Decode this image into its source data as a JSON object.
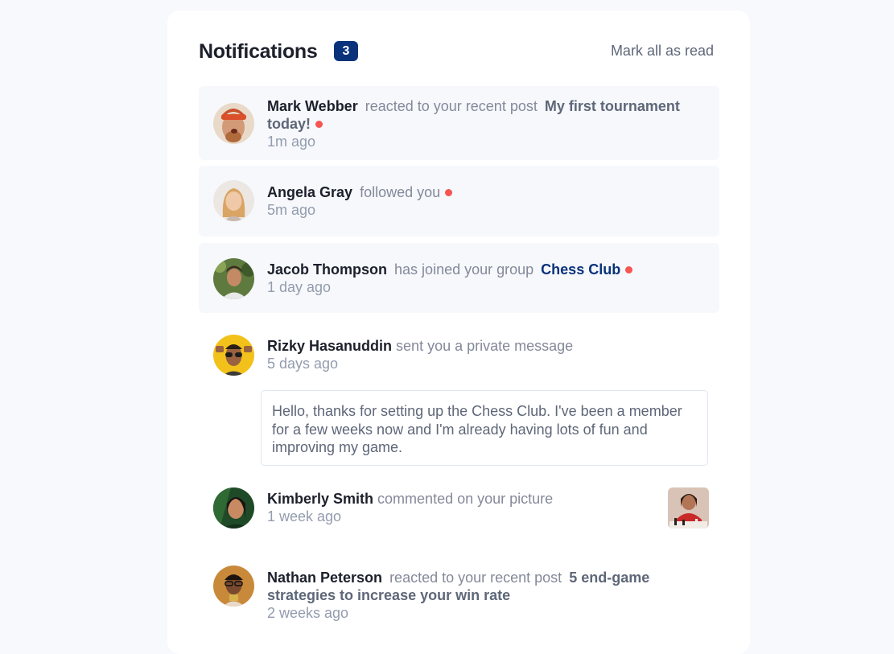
{
  "header": {
    "title": "Notifications",
    "unread_count": "3",
    "mark_all_label": "Mark all as read"
  },
  "notifications": [
    {
      "name": "Mark Webber",
      "action": "reacted to your recent post",
      "target": "My first tournament today!",
      "time": "1m ago",
      "unread": true
    },
    {
      "name": "Angela Gray",
      "action": "followed you",
      "time": "5m ago",
      "unread": true
    },
    {
      "name": "Jacob Thompson",
      "action": "has joined your group",
      "target": "Chess Club",
      "time": "1 day ago",
      "unread": true
    },
    {
      "name": "Rizky Hasanuddin",
      "action": "sent you a private message",
      "time": "5 days ago",
      "message": "Hello, thanks for setting up the Chess Club. I've been a member for a few weeks now and I'm already having lots of fun and improving my game.",
      "unread": false
    },
    {
      "name": "Kimberly Smith",
      "action": "commented on your picture",
      "time": "1 week ago",
      "unread": false
    },
    {
      "name": "Nathan Peterson",
      "action": "reacted to your recent post",
      "target": "5 end-game strategies to increase your win rate",
      "time": "2 weeks ago",
      "unread": false
    }
  ],
  "colors": {
    "unread_dot": "#f65552",
    "badge": "#0a327b",
    "unread_bg": "#f6f8fc"
  }
}
